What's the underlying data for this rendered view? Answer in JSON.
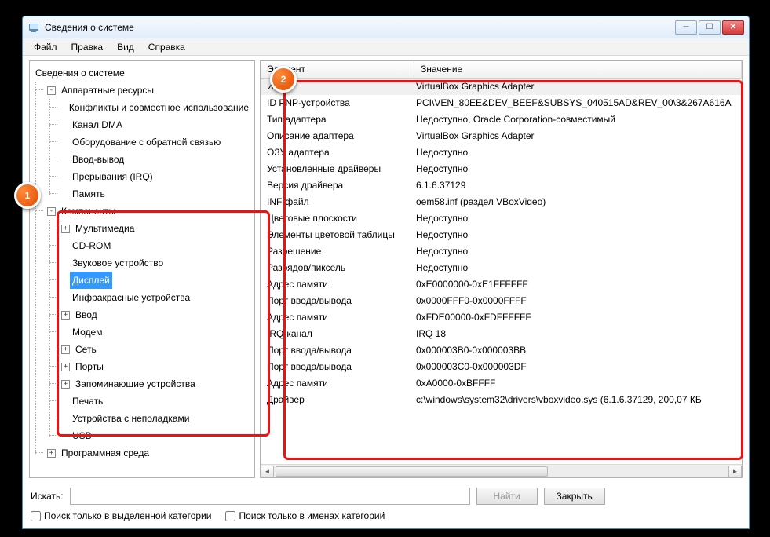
{
  "window": {
    "title": "Сведения о системе"
  },
  "menu": {
    "file": "Файл",
    "edit": "Правка",
    "view": "Вид",
    "help": "Справка"
  },
  "tree": {
    "root": "Сведения о системе",
    "hardware": {
      "label": "Аппаратные ресурсы",
      "children": [
        "Конфликты и совместное использование",
        "Канал DMA",
        "Оборудование с обратной связью",
        "Ввод-вывод",
        "Прерывания (IRQ)",
        "Память"
      ]
    },
    "components": {
      "label": "Компоненты",
      "children": [
        {
          "label": "Мультимедиа",
          "expandable": true
        },
        {
          "label": "CD-ROM",
          "expandable": false
        },
        {
          "label": "Звуковое устройство",
          "expandable": false
        },
        {
          "label": "Дисплей",
          "expandable": false,
          "selected": true
        },
        {
          "label": "Инфракрасные устройства",
          "expandable": false
        },
        {
          "label": "Ввод",
          "expandable": true
        },
        {
          "label": "Модем",
          "expandable": false
        },
        {
          "label": "Сеть",
          "expandable": true
        },
        {
          "label": "Порты",
          "expandable": true
        },
        {
          "label": "Запоминающие устройства",
          "expandable": true
        },
        {
          "label": "Печать",
          "expandable": false
        },
        {
          "label": "Устройства с неполадками",
          "expandable": false
        },
        {
          "label": "USB",
          "expandable": false
        }
      ]
    },
    "software": {
      "label": "Программная среда"
    }
  },
  "detail": {
    "columns": {
      "name": "Элемент",
      "value": "Значение"
    },
    "rows": [
      {
        "name": "Имя",
        "value": "VirtualBox Graphics Adapter",
        "selected": true
      },
      {
        "name": "ID PNP-устройства",
        "value": "PCI\\VEN_80EE&DEV_BEEF&SUBSYS_040515AD&REV_00\\3&267A616A"
      },
      {
        "name": "Тип адаптера",
        "value": "Недоступно, Oracle Corporation-совместимый"
      },
      {
        "name": "Описание адаптера",
        "value": "VirtualBox Graphics Adapter"
      },
      {
        "name": "ОЗУ адаптера",
        "value": "Недоступно"
      },
      {
        "name": "Установленные драйверы",
        "value": "Недоступно"
      },
      {
        "name": "Версия драйвера",
        "value": "6.1.6.37129"
      },
      {
        "name": "INF-файл",
        "value": "oem58.inf (раздел VBoxVideo)"
      },
      {
        "name": "Цветовые плоскости",
        "value": "Недоступно"
      },
      {
        "name": "Элементы цветовой таблицы",
        "value": "Недоступно"
      },
      {
        "name": "Разрешение",
        "value": "Недоступно"
      },
      {
        "name": "Разрядов/пиксель",
        "value": "Недоступно"
      },
      {
        "name": "Адрес памяти",
        "value": "0xE0000000-0xE1FFFFFF"
      },
      {
        "name": "Порт ввода/вывода",
        "value": "0x0000FFF0-0x0000FFFF"
      },
      {
        "name": "Адрес памяти",
        "value": "0xFDE00000-0xFDFFFFFF"
      },
      {
        "name": "IRQ-канал",
        "value": "IRQ 18"
      },
      {
        "name": "Порт ввода/вывода",
        "value": "0x000003B0-0x000003BB"
      },
      {
        "name": "Порт ввода/вывода",
        "value": "0x000003C0-0x000003DF"
      },
      {
        "name": "Адрес памяти",
        "value": "0xA0000-0xBFFFF"
      },
      {
        "name": "Драйвер",
        "value": "c:\\windows\\system32\\drivers\\vboxvideo.sys (6.1.6.37129, 200,07 КБ"
      }
    ]
  },
  "search": {
    "label": "Искать:",
    "find": "Найти",
    "close": "Закрыть",
    "chk_category": "Поиск только в выделенной категории",
    "chk_names": "Поиск только в именах категорий"
  },
  "badges": {
    "one": "1",
    "two": "2"
  }
}
